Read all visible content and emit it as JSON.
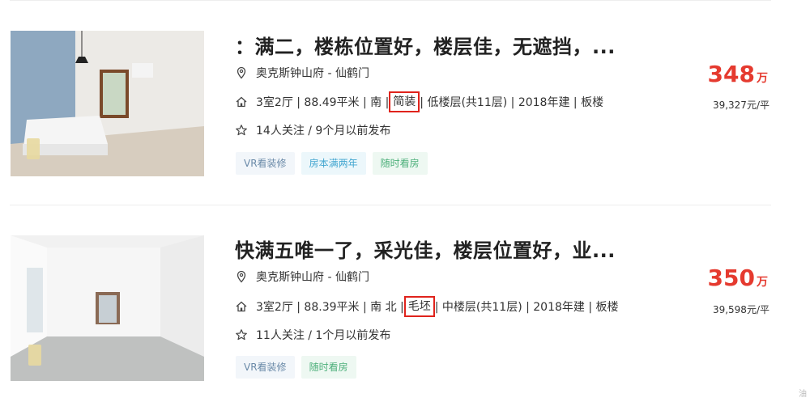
{
  "listings": [
    {
      "title": "：满二，楼栋位置好，楼层佳，无遮挡，...",
      "location": "奥克斯钟山府 - 仙鹤门",
      "info_before": "3室2厅 | 88.49平米 | 南 |",
      "info_highlight": "简装",
      "info_after": "| 低楼层(共11层) | 2018年建 | 板楼",
      "follow": "14人关注 / 9个月以前发布",
      "tags": [
        "VR看装修",
        "房本满两年",
        "随时看房"
      ],
      "price": "348",
      "price_unit": "万",
      "unit_price": "39,327元/平"
    },
    {
      "title": "快满五唯一了，采光佳，楼层位置好，业...",
      "location": "奥克斯钟山府 - 仙鹤门",
      "info_before": "3室2厅 | 88.39平米 | 南 北 |",
      "info_highlight": "毛坯",
      "info_after": "| 中楼层(共11层) | 2018年建 | 板楼",
      "follow": "11人关注 / 1个月以前发布",
      "tags": [
        "VR看装修",
        "随时看房"
      ],
      "price": "350",
      "price_unit": "万",
      "unit_price": "39,598元/平"
    }
  ],
  "icons": {
    "location": "location-pin-icon",
    "house": "house-icon",
    "star": "star-icon"
  },
  "colors": {
    "price": "#e53a2f",
    "highlight_box": "#e0231c"
  },
  "corner_text": "油"
}
